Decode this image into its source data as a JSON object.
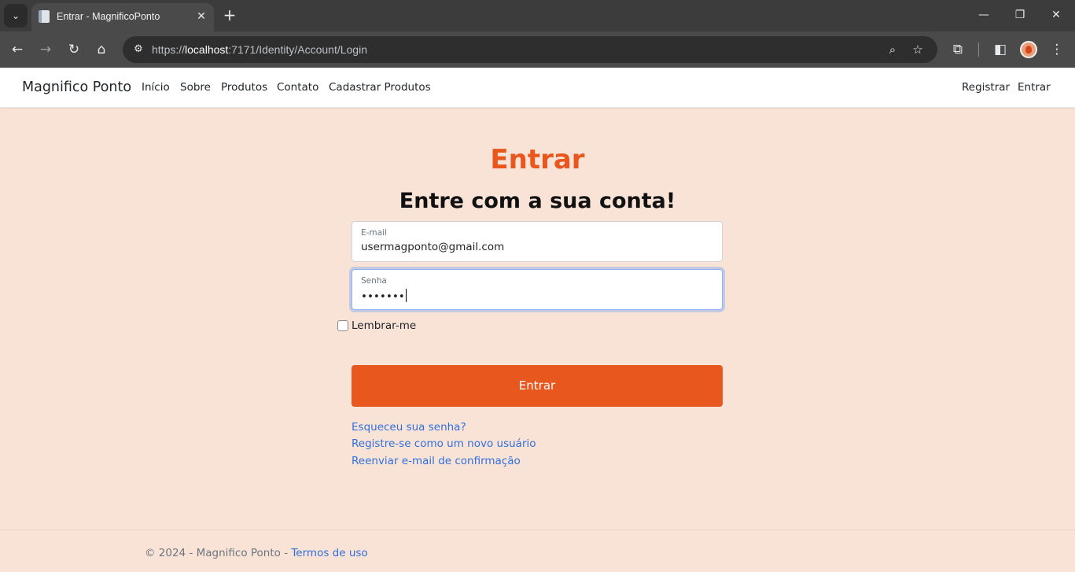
{
  "browser": {
    "tab_title": "Entrar - MagnificoPonto",
    "url_prefix": "https://",
    "url_host": "localhost",
    "url_rest": ":7171/Identity/Account/Login"
  },
  "navbar": {
    "brand": "Magnifico Ponto",
    "links": [
      "Início",
      "Sobre",
      "Produtos",
      "Contato",
      "Cadastrar Produtos"
    ],
    "right_links": [
      "Registrar",
      "Entrar"
    ]
  },
  "login": {
    "title": "Entrar",
    "subtitle": "Entre com a sua conta!",
    "email_label": "E-mail",
    "email_value": "usermagponto@gmail.com",
    "password_label": "Senha",
    "password_value": "•••••••",
    "remember_label": "Lembrar-me",
    "submit_label": "Entrar",
    "links": {
      "forgot": "Esqueceu sua senha?",
      "register": "Registre-se como um novo usuário",
      "resend": "Reenviar e-mail de confirmação"
    }
  },
  "footer": {
    "text": "© 2024 - Magnifico Ponto - ",
    "terms": "Termos de uso"
  },
  "colors": {
    "accent": "#e8571e",
    "background": "#f9e3d7",
    "link": "#2f6fdc"
  }
}
